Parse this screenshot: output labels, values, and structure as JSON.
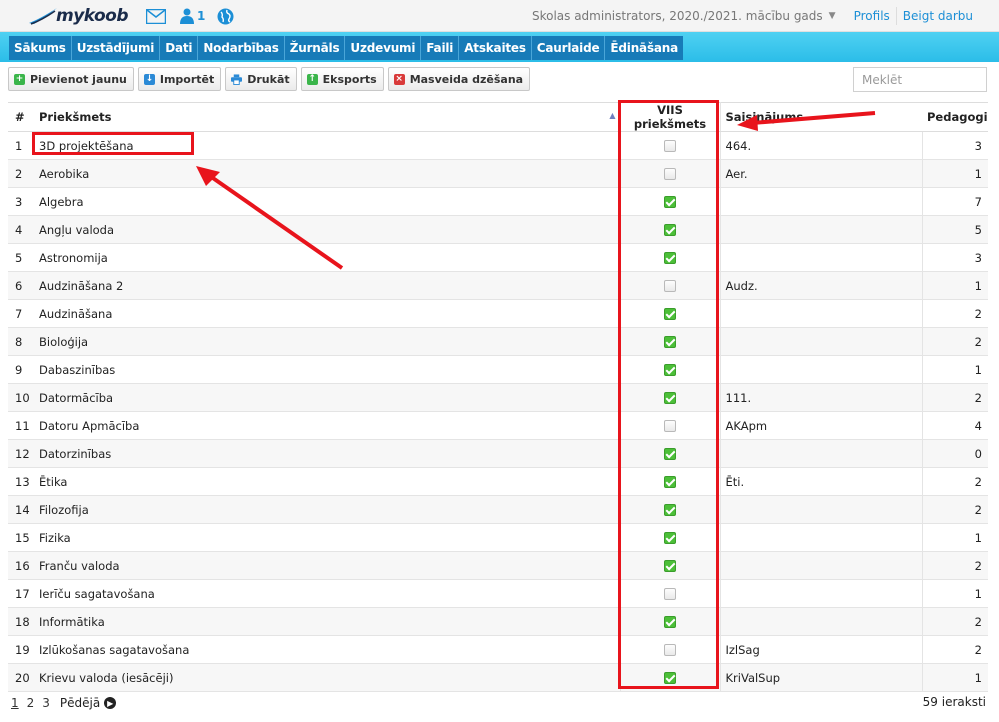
{
  "header": {
    "logo_text": "mykoob",
    "user_count": "1",
    "school_year": "Skolas administrators, 2020./2021. mācību gads",
    "profile_link": "Profils",
    "logout_link": "Beigt darbu"
  },
  "nav": {
    "items": [
      "Sākums",
      "Uzstādījumi",
      "Dati",
      "Nodarbības",
      "Žurnāls",
      "Uzdevumi",
      "Faili",
      "Atskaites",
      "Caurlaide",
      "Ēdināšana"
    ]
  },
  "toolbar": {
    "add_label": "Pievienot jaunu",
    "import_label": "Importēt",
    "print_label": "Drukāt",
    "export_label": "Eksports",
    "mass_delete_label": "Masveida dzēšana"
  },
  "search": {
    "placeholder": "Meklēt"
  },
  "table": {
    "headers": {
      "num": "#",
      "subject": "Priekšmets",
      "viis": "VIIS priekšmets",
      "link": "Saisinājums",
      "teachers": "Pedagogi"
    },
    "rows": [
      {
        "num": "1",
        "subject": "3D projektēšana",
        "viis": false,
        "link": "464.",
        "teachers": "3"
      },
      {
        "num": "2",
        "subject": "Aerobika",
        "viis": false,
        "link": "Aer.",
        "teachers": "1"
      },
      {
        "num": "3",
        "subject": "Algebra",
        "viis": true,
        "link": "",
        "teachers": "7"
      },
      {
        "num": "4",
        "subject": "Angļu valoda",
        "viis": true,
        "link": "",
        "teachers": "5"
      },
      {
        "num": "5",
        "subject": "Astronomija",
        "viis": true,
        "link": "",
        "teachers": "3"
      },
      {
        "num": "6",
        "subject": "Audzināšana 2",
        "viis": false,
        "link": "Audz.",
        "teachers": "1"
      },
      {
        "num": "7",
        "subject": "Audzināšana",
        "viis": true,
        "link": "",
        "teachers": "2"
      },
      {
        "num": "8",
        "subject": "Bioloģija",
        "viis": true,
        "link": "",
        "teachers": "2"
      },
      {
        "num": "9",
        "subject": "Dabaszinības",
        "viis": true,
        "link": "",
        "teachers": "1"
      },
      {
        "num": "10",
        "subject": "Datormācība",
        "viis": true,
        "link": "111.",
        "teachers": "2"
      },
      {
        "num": "11",
        "subject": "Datoru Apmācība",
        "viis": false,
        "link": "AKApm",
        "teachers": "4"
      },
      {
        "num": "12",
        "subject": "Datorzinības",
        "viis": true,
        "link": "",
        "teachers": "0"
      },
      {
        "num": "13",
        "subject": "Ētika",
        "viis": true,
        "link": "Ēti.",
        "teachers": "2"
      },
      {
        "num": "14",
        "subject": "Filozofija",
        "viis": true,
        "link": "",
        "teachers": "2"
      },
      {
        "num": "15",
        "subject": "Fizika",
        "viis": true,
        "link": "",
        "teachers": "1"
      },
      {
        "num": "16",
        "subject": "Franču valoda",
        "viis": true,
        "link": "",
        "teachers": "2"
      },
      {
        "num": "17",
        "subject": "Ierīču sagatavošana",
        "viis": false,
        "link": "",
        "teachers": "1"
      },
      {
        "num": "18",
        "subject": "Informātika",
        "viis": true,
        "link": "",
        "teachers": "2"
      },
      {
        "num": "19",
        "subject": "Izlūkošanas sagatavošana",
        "viis": false,
        "link": "IzlSag",
        "teachers": "2"
      },
      {
        "num": "20",
        "subject": "Krievu valoda (iesācēji)",
        "viis": true,
        "link": "KriValSup",
        "teachers": "1"
      }
    ]
  },
  "pager": {
    "pages": [
      "1",
      "2",
      "3"
    ],
    "last_label": "Pēdējā",
    "records": "59 ieraksti"
  },
  "colors": {
    "accent": "#1c8fd6",
    "nav_bg": "#177bb8",
    "nav_strip": "#2bbde8",
    "checkbox_on": "#4cbf38",
    "annotation": "#e8141c"
  }
}
